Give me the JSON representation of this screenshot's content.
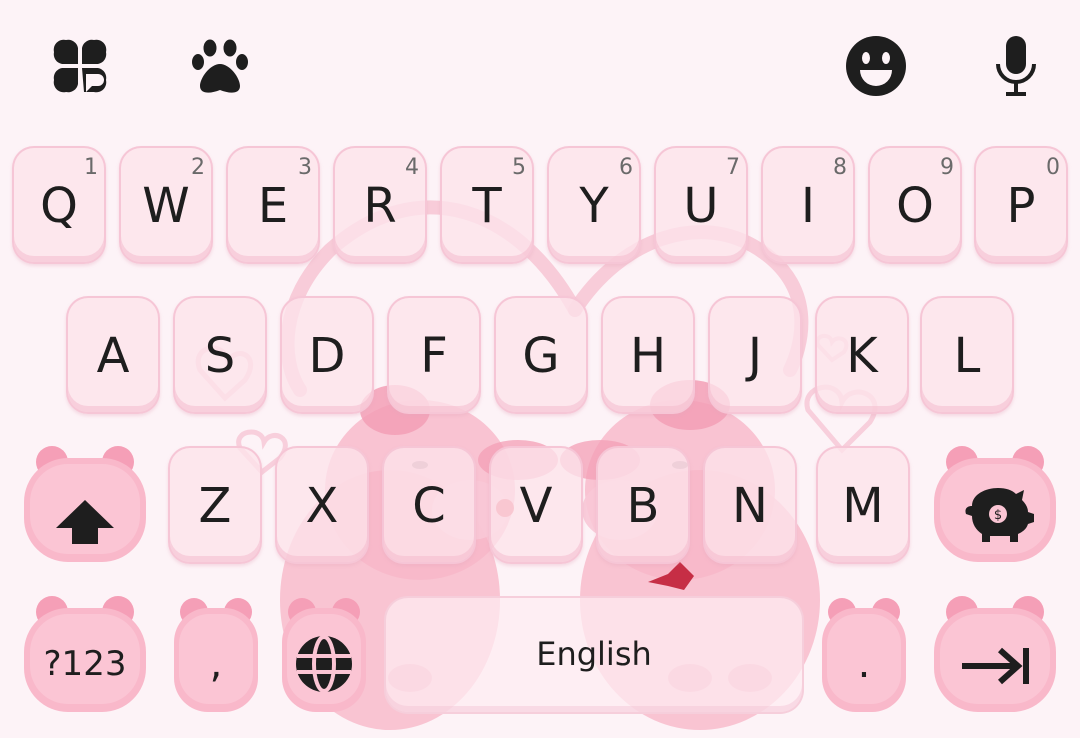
{
  "toolbar": {
    "left_icons": [
      "clover-icon",
      "paw-icon"
    ],
    "right_icons": [
      "emoji-icon",
      "microphone-icon"
    ]
  },
  "keyboard": {
    "row1": [
      {
        "label": "Q",
        "hint": "1"
      },
      {
        "label": "W",
        "hint": "2"
      },
      {
        "label": "E",
        "hint": "3"
      },
      {
        "label": "R",
        "hint": "4"
      },
      {
        "label": "T",
        "hint": "5"
      },
      {
        "label": "Y",
        "hint": "6"
      },
      {
        "label": "U",
        "hint": "7"
      },
      {
        "label": "I",
        "hint": "8"
      },
      {
        "label": "O",
        "hint": "9"
      },
      {
        "label": "P",
        "hint": "0"
      }
    ],
    "row2": [
      {
        "label": "A"
      },
      {
        "label": "S"
      },
      {
        "label": "D"
      },
      {
        "label": "F"
      },
      {
        "label": "G"
      },
      {
        "label": "H"
      },
      {
        "label": "J"
      },
      {
        "label": "K"
      },
      {
        "label": "L"
      }
    ],
    "row3": [
      {
        "label": "Z"
      },
      {
        "label": "X"
      },
      {
        "label": "C"
      },
      {
        "label": "V"
      },
      {
        "label": "B"
      },
      {
        "label": "N"
      },
      {
        "label": "M"
      }
    ],
    "shift_icon": "shift-arrow-icon",
    "piggy_bank_icon": "piggy-bank-icon",
    "symbols_label": "?123",
    "comma_label": ",",
    "globe_icon": "globe-icon",
    "space_label": "English",
    "period_label": ".",
    "enter_icon": "tab-arrow-icon"
  },
  "theme": {
    "background": "#fdf3f7",
    "key_fill": "#fce3eb",
    "pig_key_fill": "#f9b8ca",
    "accent_dark": "#1e1e1e"
  }
}
